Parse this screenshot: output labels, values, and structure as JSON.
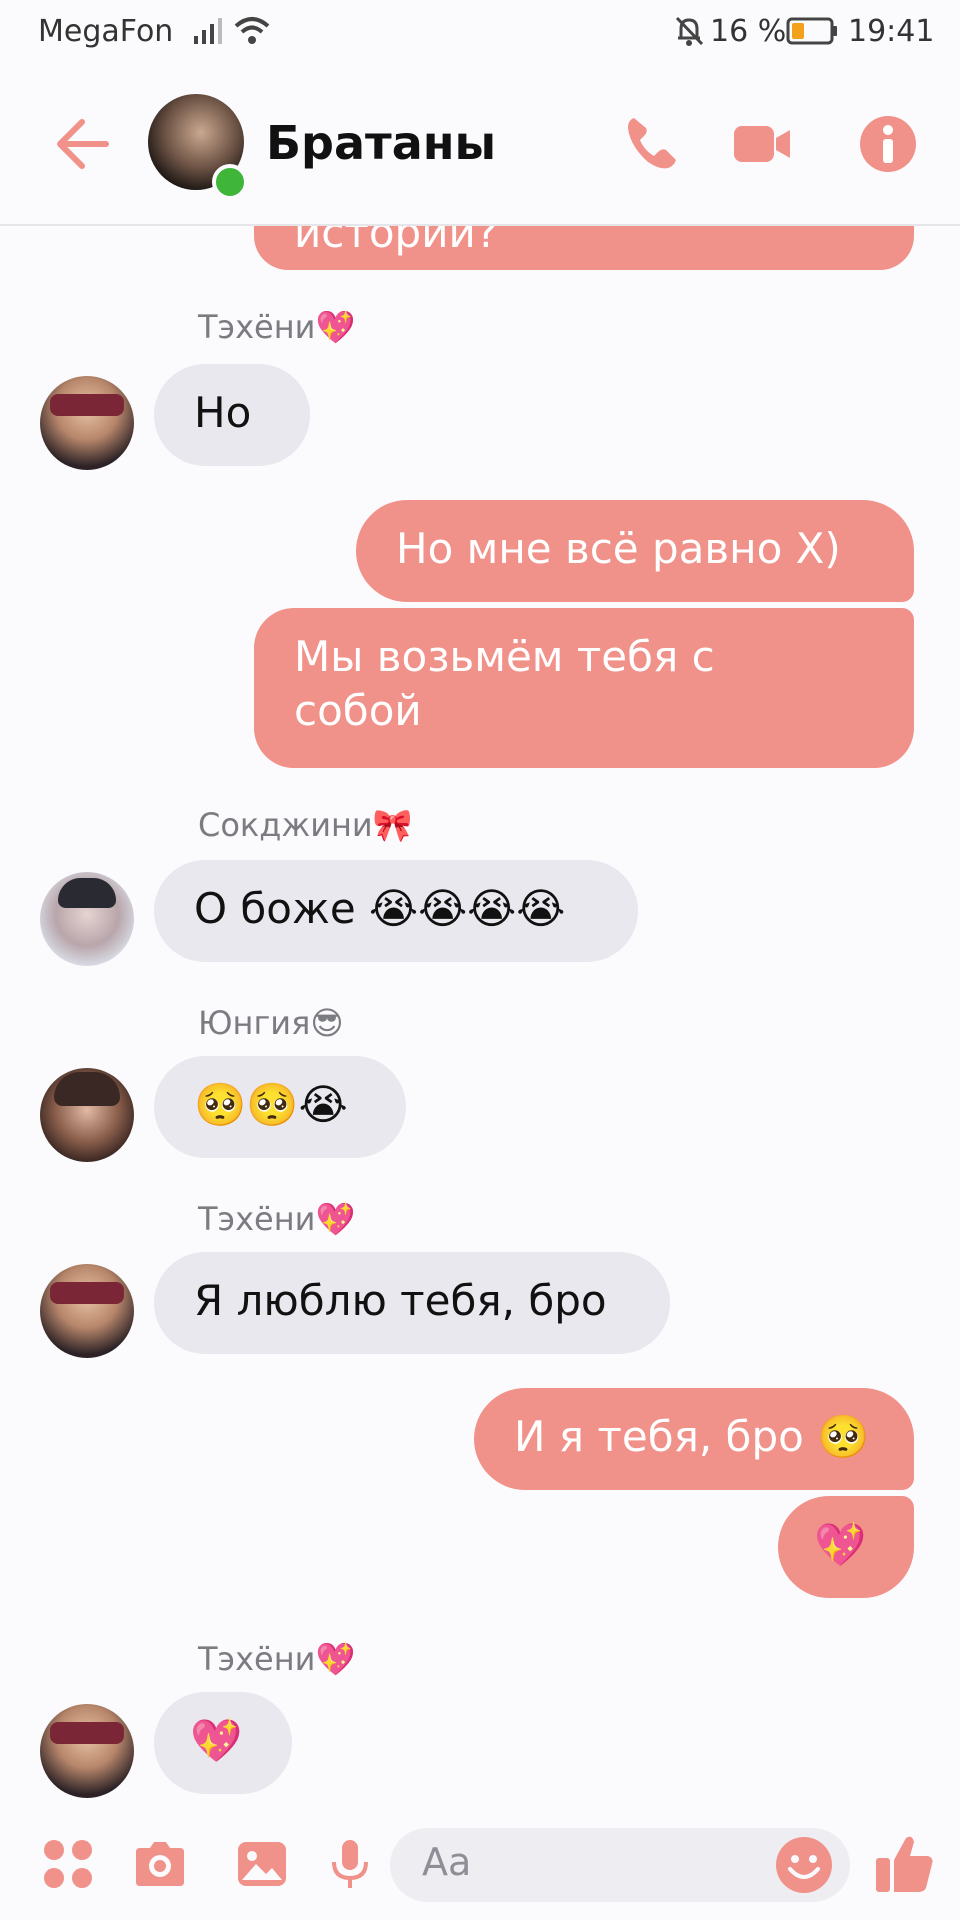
{
  "status_bar": {
    "carrier": "MegaFon",
    "battery": "16 %",
    "time": "19:41",
    "icons": [
      "signal-icon",
      "wifi-icon",
      "bell-off-icon",
      "battery-low-icon"
    ]
  },
  "header": {
    "title": "Братаны",
    "online": true,
    "icons": [
      "back-arrow-icon",
      "phone-icon",
      "video-camera-icon",
      "info-icon"
    ]
  },
  "colors": {
    "accent": "#f0918a",
    "outgoing_bubble": "#f0918a",
    "incoming_bubble": "#e9e8ee",
    "online_dot": "#3fb53a"
  },
  "messages": {
    "m0": {
      "text": "истории?",
      "direction": "out"
    },
    "m1_sender": "Тэхёни💖",
    "m1": {
      "text": "Но",
      "direction": "in"
    },
    "m2": {
      "text": "Но мне всё равно Х)",
      "direction": "out"
    },
    "m3": {
      "line1": "Мы возьмём тебя с",
      "line2": "собой",
      "direction": "out"
    },
    "m4_sender": "Сокджини🎀",
    "m4": {
      "text": "О боже 😭😭😭😭",
      "direction": "in"
    },
    "m5_sender": "Юнгия😎",
    "m5": {
      "text": "🥺🥺😭",
      "direction": "in"
    },
    "m6_sender": "Тэхёни💖",
    "m6": {
      "text": "Я люблю тебя, бро",
      "direction": "in"
    },
    "m7": {
      "text": "И я тебя, бро 🥺",
      "direction": "out"
    },
    "m8": {
      "text": "💖",
      "direction": "out"
    },
    "m9_sender": "Тэхёни💖",
    "m9": {
      "text": "💖",
      "direction": "in"
    }
  },
  "composer": {
    "placeholder": "Aa",
    "icons": [
      "apps-icon",
      "camera-icon",
      "image-icon",
      "microphone-icon",
      "emoji-icon",
      "thumbs-up-icon"
    ]
  }
}
